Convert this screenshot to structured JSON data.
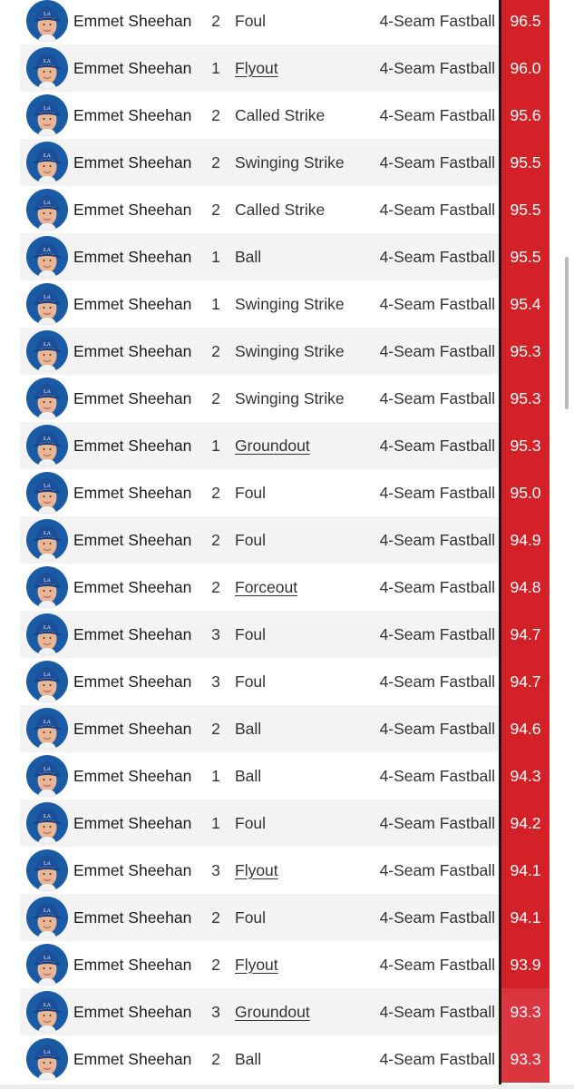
{
  "colors": {
    "velo_high": "#d42027",
    "velo_mid": "#db3540",
    "divider": "#1a1a1a"
  },
  "rows": [
    {
      "pitcher": "Emmet Sheehan",
      "inning": "2",
      "result": "Foul",
      "result_link": false,
      "pitch": "4-Seam Fastball",
      "velo": "96.5"
    },
    {
      "pitcher": "Emmet Sheehan",
      "inning": "1",
      "result": "Flyout",
      "result_link": true,
      "pitch": "4-Seam Fastball",
      "velo": "96.0"
    },
    {
      "pitcher": "Emmet Sheehan",
      "inning": "2",
      "result": "Called Strike",
      "result_link": false,
      "pitch": "4-Seam Fastball",
      "velo": "95.6"
    },
    {
      "pitcher": "Emmet Sheehan",
      "inning": "2",
      "result": "Swinging Strike",
      "result_link": false,
      "pitch": "4-Seam Fastball",
      "velo": "95.5"
    },
    {
      "pitcher": "Emmet Sheehan",
      "inning": "2",
      "result": "Called Strike",
      "result_link": false,
      "pitch": "4-Seam Fastball",
      "velo": "95.5"
    },
    {
      "pitcher": "Emmet Sheehan",
      "inning": "1",
      "result": "Ball",
      "result_link": false,
      "pitch": "4-Seam Fastball",
      "velo": "95.5"
    },
    {
      "pitcher": "Emmet Sheehan",
      "inning": "1",
      "result": "Swinging Strike",
      "result_link": false,
      "pitch": "4-Seam Fastball",
      "velo": "95.4"
    },
    {
      "pitcher": "Emmet Sheehan",
      "inning": "2",
      "result": "Swinging Strike",
      "result_link": false,
      "pitch": "4-Seam Fastball",
      "velo": "95.3"
    },
    {
      "pitcher": "Emmet Sheehan",
      "inning": "2",
      "result": "Swinging Strike",
      "result_link": false,
      "pitch": "4-Seam Fastball",
      "velo": "95.3"
    },
    {
      "pitcher": "Emmet Sheehan",
      "inning": "1",
      "result": "Groundout",
      "result_link": true,
      "pitch": "4-Seam Fastball",
      "velo": "95.3"
    },
    {
      "pitcher": "Emmet Sheehan",
      "inning": "2",
      "result": "Foul",
      "result_link": false,
      "pitch": "4-Seam Fastball",
      "velo": "95.0"
    },
    {
      "pitcher": "Emmet Sheehan",
      "inning": "2",
      "result": "Foul",
      "result_link": false,
      "pitch": "4-Seam Fastball",
      "velo": "94.9"
    },
    {
      "pitcher": "Emmet Sheehan",
      "inning": "2",
      "result": "Forceout",
      "result_link": true,
      "pitch": "4-Seam Fastball",
      "velo": "94.8"
    },
    {
      "pitcher": "Emmet Sheehan",
      "inning": "3",
      "result": "Foul",
      "result_link": false,
      "pitch": "4-Seam Fastball",
      "velo": "94.7"
    },
    {
      "pitcher": "Emmet Sheehan",
      "inning": "3",
      "result": "Foul",
      "result_link": false,
      "pitch": "4-Seam Fastball",
      "velo": "94.7"
    },
    {
      "pitcher": "Emmet Sheehan",
      "inning": "2",
      "result": "Ball",
      "result_link": false,
      "pitch": "4-Seam Fastball",
      "velo": "94.6"
    },
    {
      "pitcher": "Emmet Sheehan",
      "inning": "1",
      "result": "Ball",
      "result_link": false,
      "pitch": "4-Seam Fastball",
      "velo": "94.3"
    },
    {
      "pitcher": "Emmet Sheehan",
      "inning": "1",
      "result": "Foul",
      "result_link": false,
      "pitch": "4-Seam Fastball",
      "velo": "94.2"
    },
    {
      "pitcher": "Emmet Sheehan",
      "inning": "3",
      "result": "Flyout",
      "result_link": true,
      "pitch": "4-Seam Fastball",
      "velo": "94.1"
    },
    {
      "pitcher": "Emmet Sheehan",
      "inning": "2",
      "result": "Foul",
      "result_link": false,
      "pitch": "4-Seam Fastball",
      "velo": "94.1"
    },
    {
      "pitcher": "Emmet Sheehan",
      "inning": "2",
      "result": "Flyout",
      "result_link": true,
      "pitch": "4-Seam Fastball",
      "velo": "93.9"
    },
    {
      "pitcher": "Emmet Sheehan",
      "inning": "3",
      "result": "Groundout",
      "result_link": true,
      "pitch": "4-Seam Fastball",
      "velo": "93.3"
    },
    {
      "pitcher": "Emmet Sheehan",
      "inning": "2",
      "result": "Ball",
      "result_link": false,
      "pitch": "4-Seam Fastball",
      "velo": "93.3"
    }
  ]
}
